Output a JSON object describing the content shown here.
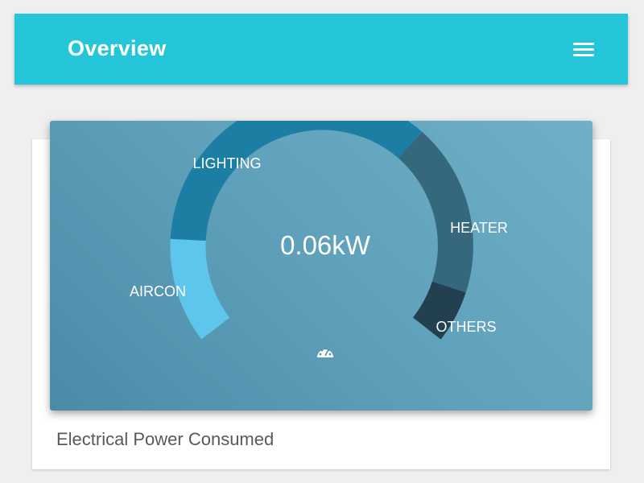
{
  "header": {
    "title": "Overview",
    "menu_icon": "hamburger-menu-icon"
  },
  "gauge": {
    "value_text": "0.06kW",
    "center_icon": "speedometer-icon",
    "segments": [
      {
        "label": "AIRCON",
        "color": "#5ec6ec"
      },
      {
        "label": "LIGHTING",
        "color": "#1c7ea3"
      },
      {
        "label": "HEATER",
        "color": "#35687c"
      },
      {
        "label": "OTHERS",
        "color": "#234050"
      }
    ]
  },
  "card": {
    "caption": "Electrical Power Consumed"
  },
  "colors": {
    "app_bar": "#25c6da",
    "background": "#efefef",
    "card": "#ffffff"
  }
}
